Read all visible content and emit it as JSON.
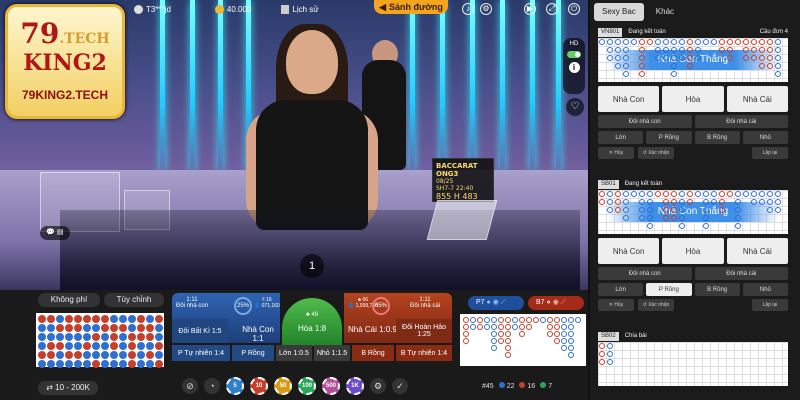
{
  "logo": {
    "line1": "79",
    "line1b": ".TECH",
    "line2": "KING2",
    "caption": "79KING2.TECH"
  },
  "topbar": {
    "user": "T3***jd",
    "balance": "40.000",
    "history": "Lịch sử",
    "lobby": "Sảnh đường"
  },
  "video": {
    "shoe_title": "BACCARAT ONG3",
    "shoe_line1": "08/25",
    "shoe_line2": "SH7-7  22:40",
    "shoe_line3": "855 H 483",
    "round": "1",
    "chat": "💬 ▤",
    "hd": "HD",
    "info": "i",
    "heart": "♡"
  },
  "bottom": {
    "tab_commission": "Không phí",
    "tab_custom": "Tùy chỉnh",
    "limit": "⇄  10 - 200K",
    "player_ratio": "1:11",
    "player_pair": "Đôi nhà con",
    "player_pct": "25%",
    "player_amt": "₫ 16\n👤 071,160",
    "player_label": "Nhà Con",
    "player_odds": "1:1",
    "tie_ratio": "♣ 46",
    "tie_label": "Hòa",
    "tie_odds": "1:8",
    "banker_pct": "65%",
    "banker_amt": "♣ 66\n👤 1,999,760",
    "banker_ratio": "1:11",
    "banker_pair": "Đôi nhà cái",
    "banker_label": "Nhà Cái",
    "banker_odds": "1:0.95",
    "pair_left": "Đôi Bất Kì 1:5",
    "pair_right": "Đôi Hoàn Hảo 1:25",
    "row2": [
      "P Tự nhiên 1:4",
      "P Rồng",
      "Lớn 1:0.5",
      "Nhỏ 1:1.5",
      "B Rồng",
      "B Tự nhiên 1:4"
    ],
    "p7": "P7",
    "b7": "B7",
    "chips": [
      "5",
      "10",
      "50",
      "100",
      "500",
      "1K"
    ],
    "stats": {
      "total": "#45",
      "p": "22",
      "b": "16",
      "t": "7"
    }
  },
  "sidebar": {
    "tabs": [
      "Sexy Bac",
      "Khác"
    ],
    "tables": [
      {
        "id": "VN801",
        "status": "Đang kết toán",
        "extra": "Cầu đơn 4",
        "banner": "Nhà Con Thắng",
        "show_banner": true
      },
      {
        "id": "SB01",
        "status": "Đang kết toán",
        "extra": "",
        "banner": "Nhà Con Thắng",
        "show_banner": true
      },
      {
        "id": "SB02",
        "status": "Chia bài",
        "extra": "",
        "banner": "",
        "show_banner": false
      }
    ],
    "row1": [
      "Nhà Con",
      "Hòa",
      "Nhà Cái"
    ],
    "row2": [
      "Đôi nhà con",
      "Đôi nhà cái"
    ],
    "row3": [
      "Lớn",
      "P Rồng",
      "B Rồng",
      "Nhỏ"
    ],
    "row4": [
      "✕ Hủy",
      "↺ Xác nhận",
      "Lặp lại"
    ]
  }
}
